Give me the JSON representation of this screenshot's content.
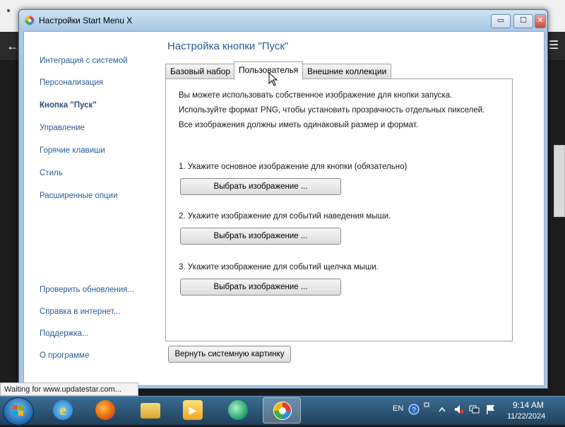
{
  "window": {
    "title": "Настройки Start Menu X",
    "controls": {
      "minimize": "▭",
      "maximize": "☐",
      "close": "✕"
    }
  },
  "sidebar": {
    "items": [
      {
        "label": "Интеграция с системой",
        "active": false
      },
      {
        "label": "Персонализация",
        "active": false
      },
      {
        "label": "Кнопка \"Пуск\"",
        "active": true
      },
      {
        "label": "Управление",
        "active": false
      },
      {
        "label": "Горячие клавиши",
        "active": false
      },
      {
        "label": "Стиль",
        "active": false
      },
      {
        "label": "Расширенные опции",
        "active": false
      }
    ],
    "links": [
      {
        "label": "Проверить обновления..."
      },
      {
        "label": "Справка в интернет..."
      },
      {
        "label": "Поддержка..."
      },
      {
        "label": "О программе"
      }
    ]
  },
  "main": {
    "title": "Настройка кнопки \"Пуск\"",
    "tabs": [
      {
        "label": "Базовый набор",
        "selected": false
      },
      {
        "label": "Пользователья",
        "selected": true
      },
      {
        "label": "Внешние коллекции",
        "selected": false
      }
    ],
    "intro": [
      "Вы можете использовать собственное изображение для кнопки запуска.",
      "Используйте формат PNG, чтобы установить прозрачность отдельных пикселей.",
      "Все изображения должны иметь одинаковый размер и формат."
    ],
    "steps": [
      {
        "label": "1. Укажите основное изображение для кнопки (обязательно)",
        "button": "Выбрать изображение ..."
      },
      {
        "label": "2. Укажите изображение для событий наведения мыши.",
        "button": "Выбрать изображение ..."
      },
      {
        "label": "3. Укажите изображение для событий щелчка мыши.",
        "button": "Выбрать изображение ..."
      }
    ],
    "reset_button": "Вернуть системную картинку"
  },
  "status_bar": {
    "text": "Waiting for www.updatestar.com..."
  },
  "taskbar": {
    "apps": [
      {
        "icon": "internet-explorer-icon"
      },
      {
        "icon": "firefox-icon"
      },
      {
        "icon": "file-explorer-icon"
      },
      {
        "icon": "media-player-icon"
      },
      {
        "icon": "chat-app-icon"
      },
      {
        "icon": "start-menu-x-icon",
        "active": true
      }
    ],
    "tray": {
      "language": "EN",
      "time": "9:14 AM",
      "date": "11/22/2024"
    }
  },
  "colors": {
    "link": "#2a5d9a",
    "title_bar": "#a7c7e4",
    "taskbar": "#20405a"
  }
}
